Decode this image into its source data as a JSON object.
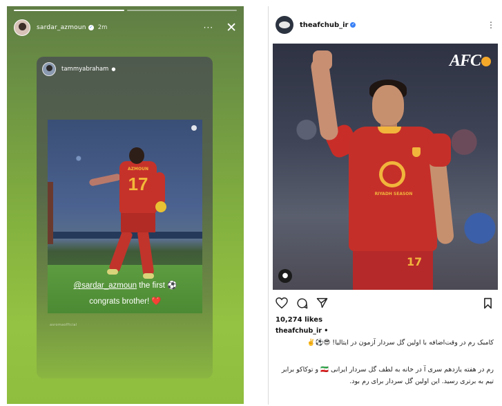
{
  "story": {
    "username": "sardar_azmoun",
    "time": "2m",
    "more_label": "···",
    "close_label": "✕",
    "shared_post": {
      "username": "tammyabraham",
      "photo_credit": "asromaofficial",
      "jersey_name": "AZMOUN",
      "jersey_number": "17"
    },
    "caption_mention": "@sardar_azmoun",
    "caption_line1_rest": " the first ⚽",
    "caption_line2": "congrats brother! ❤️"
  },
  "post": {
    "username": "theafchub_ir",
    "more_label": "⋮",
    "logo_text": "AFC",
    "sponsor_text": "RIYADH SEASON",
    "shorts_number": "17",
    "likes": "10,274 likes",
    "caption_user": "theafchub_ir •",
    "caption_line1": "کامبک رم در وقت‌اضافه با اولین گل سردار آزمون در ایتالیا! 😎⚽✌️",
    "caption_line2": "رم در هفته یازدهم سری آ در خانه به لطف گل سردار ایرانی 🇮🇷 و توکاکو برابر تیم به برتری رسید. این اولین گل سردار برای رم بود.",
    "icons": {
      "like": "heart-icon",
      "comment": "comment-icon",
      "share": "share-icon",
      "save": "bookmark-icon",
      "tag": "user-tag-icon"
    }
  }
}
